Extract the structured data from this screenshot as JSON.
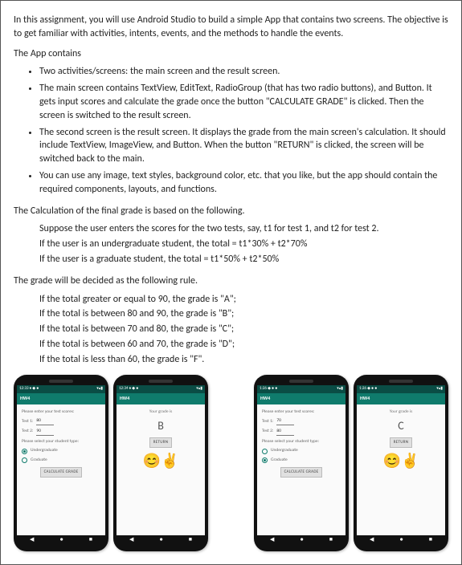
{
  "intro": "In this assignment, you will use Android Studio to build a simple App that contains two screens. The objective is to get familiar with activities, intents, events, and the methods to handle the events.",
  "contains_label": "The App contains",
  "bullets": [
    "Two activities/screens: the main screen and the result screen.",
    "The main screen contains TextView, EditText, RadioGroup (that has two radio buttons), and Button. It gets input scores and calculate the grade once the button \"CALCULATE GRADE\" is clicked. Then the screen is switched to the result screen.",
    "The second screen is the result screen. It displays the grade from the main screen's calculation. It should include TextView, ImageView, and Button. When the button \"RETURN\" is clicked, the screen will be switched back to the main.",
    "You can use any image, text styles, background color, etc. that you like, but the app should contain the required components, layouts, and functions."
  ],
  "calc_heading": "The Calculation of the final grade is based on the following.",
  "calc_lines": [
    "Suppose the user enters the scores for the two tests, say, t1 for test 1, and t2 for test 2.",
    "If the user is an undergraduate student, the total = t1*30% + t2*70%",
    "If the user is a graduate student, the total = t1*50% + t2*50%"
  ],
  "rule_heading": "The grade will be decided as the following rule.",
  "rule_lines": [
    "If the total greater or equal to 90, the grade is \"A\";",
    "If the total is between 80 and 90, the grade is \"B\";",
    "If the total is between 70 and 80, the grade is \"C\";",
    "If the total is between 60 and 70, the grade is \"D\";",
    "If the total is less than 60, the grade is \"F\"."
  ],
  "app": {
    "title": "HW4",
    "enter_label": "Please enter your test scores:",
    "test1_label": "Test 1:",
    "test2_label": "Test 2:",
    "select_label": "Please select your student type:",
    "undergrad": "Undergraduate",
    "grad": "Graduate",
    "calc_btn": "CALCULATE GRADE",
    "grade_label": "Your grade is",
    "return_btn": "RETURN"
  },
  "shots": {
    "s1": {
      "t1": "80",
      "t2": "90",
      "sel": "u"
    },
    "r1": {
      "letter": "B"
    },
    "s2": {
      "t1": "70",
      "t2": "80",
      "sel": "g"
    },
    "r2": {
      "letter": "C"
    }
  }
}
